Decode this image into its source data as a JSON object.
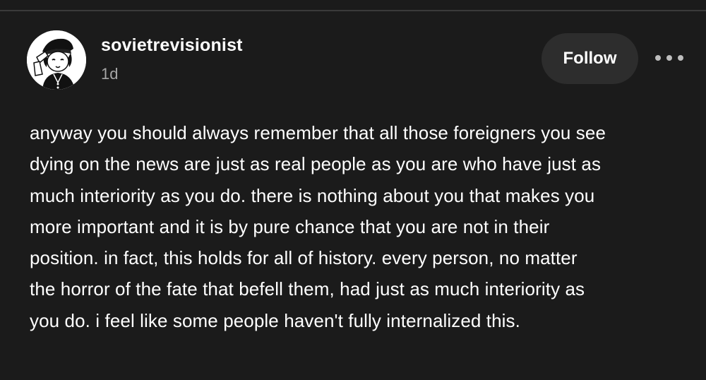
{
  "post": {
    "author": {
      "username": "sovietrevisionist",
      "avatar_icon": "avatar-icon"
    },
    "timestamp": "1d",
    "follow_label": "Follow",
    "more_icon": "more-options-icon",
    "body_lines": [
      "anyway you should always remember that all those foreigners you see",
      "dying on the news are just as real people as you are who have just as",
      "much interiority as you do. there is nothing about you that makes you",
      "more important and it is by pure chance that you are not in their",
      "position. in fact, this holds for all of history. every person, no matter",
      "the horror of the fate that befell them, had just as much interiority as",
      "you do. i feel like some people haven't fully internalized this."
    ]
  },
  "colors": {
    "background": "#1b1b1b",
    "text": "#ffffff",
    "muted": "#a6a6a6",
    "button_bg": "#2d2d2d"
  }
}
